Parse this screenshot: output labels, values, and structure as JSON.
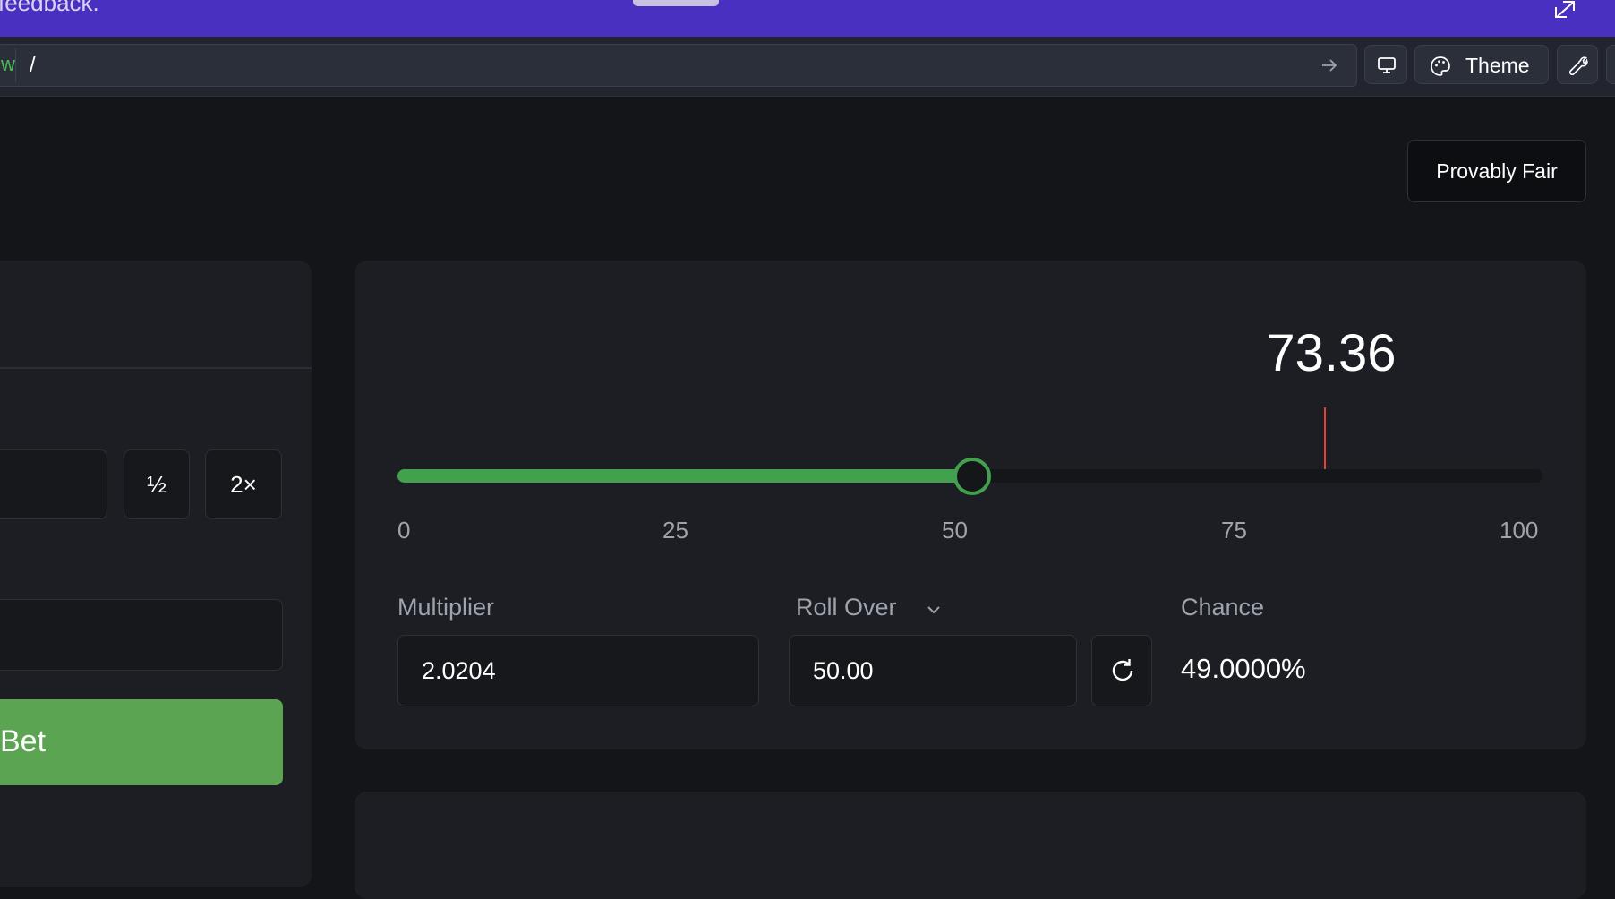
{
  "banner": {
    "text": "feedback."
  },
  "toolbar": {
    "url_prefix": "w",
    "url": "/",
    "theme_label": "Theme"
  },
  "header": {
    "provably_fair_label": "Provably Fair"
  },
  "bet_panel": {
    "half_label": "½",
    "double_label": "2×",
    "bet_label": "Bet"
  },
  "game": {
    "result": "73.36",
    "result_value": 73.36,
    "target_value": 50,
    "slider_range": [
      0,
      100
    ],
    "ticks": [
      "0",
      "25",
      "50",
      "75",
      "100"
    ],
    "multiplier_label": "Multiplier",
    "multiplier_value": "2.0204",
    "roll_label": "Roll Over",
    "roll_value": "50.00",
    "chance_label": "Chance",
    "chance_value": "49.0000%"
  },
  "colors": {
    "banner": "#4a30c0",
    "accent_green": "#41a14c",
    "bet_button": "#5aa452",
    "result_marker": "#e0453a",
    "background": "#131519",
    "panel": "#1c1e23"
  },
  "icons": {
    "open_external": "arrow-up-right-icon",
    "go": "arrow-right-icon",
    "device": "monitor-icon",
    "theme": "palette-icon",
    "tools": "wrench-icon",
    "roll_dropdown": "chevron-down-icon",
    "refresh": "refresh-icon"
  }
}
